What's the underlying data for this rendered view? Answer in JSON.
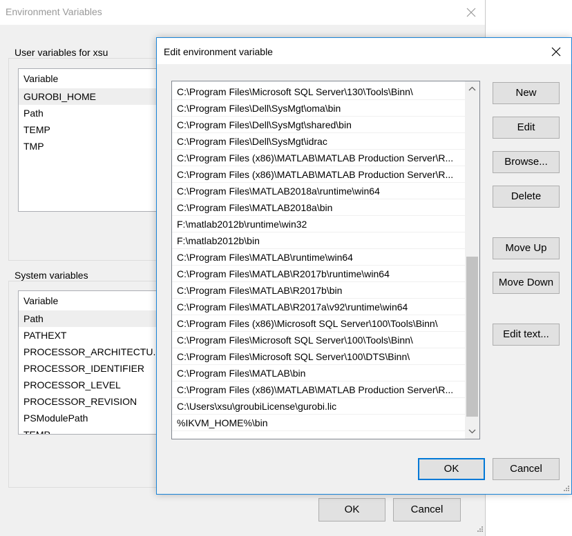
{
  "background_window": {
    "title": "Environment Variables",
    "user_group": {
      "label": "User variables for xsu",
      "column_header": "Variable",
      "rows": [
        "GUROBI_HOME",
        "Path",
        "TEMP",
        "TMP"
      ],
      "selected_index": 0
    },
    "system_group": {
      "label": "System variables",
      "column_header": "Variable",
      "rows": [
        "Path",
        "PATHEXT",
        "PROCESSOR_ARCHITECTU...",
        "PROCESSOR_IDENTIFIER",
        "PROCESSOR_LEVEL",
        "PROCESSOR_REVISION",
        "PSModulePath",
        "TEMP"
      ],
      "selected_index": 0
    },
    "buttons": {
      "ok": "OK",
      "cancel": "Cancel"
    }
  },
  "dialog": {
    "title": "Edit environment variable",
    "paths": [
      "C:\\Program Files\\Microsoft SQL Server\\130\\Tools\\Binn\\",
      "C:\\Program Files\\Dell\\SysMgt\\oma\\bin",
      "C:\\Program Files\\Dell\\SysMgt\\shared\\bin",
      "C:\\Program Files\\Dell\\SysMgt\\idrac",
      "C:\\Program Files (x86)\\MATLAB\\MATLAB Production Server\\R...",
      "C:\\Program Files (x86)\\MATLAB\\MATLAB Production Server\\R...",
      "C:\\Program Files\\MATLAB2018a\\runtime\\win64",
      "C:\\Program Files\\MATLAB2018a\\bin",
      "F:\\matlab2012b\\runtime\\win32",
      "F:\\matlab2012b\\bin",
      "C:\\Program Files\\MATLAB\\runtime\\win64",
      "C:\\Program Files\\MATLAB\\R2017b\\runtime\\win64",
      "C:\\Program Files\\MATLAB\\R2017b\\bin",
      "C:\\Program Files\\MATLAB\\R2017a\\v92\\runtime\\win64",
      "C:\\Program Files (x86)\\Microsoft SQL Server\\100\\Tools\\Binn\\",
      "C:\\Program Files\\Microsoft SQL Server\\100\\Tools\\Binn\\",
      "C:\\Program Files\\Microsoft SQL Server\\100\\DTS\\Binn\\",
      "C:\\Program Files\\MATLAB\\bin",
      "C:\\Program Files (x86)\\MATLAB\\MATLAB Production Server\\R...",
      "C:\\Users\\xsu\\groubiLicense\\gurobi.lic",
      "%IKVM_HOME%\\bin"
    ],
    "side_buttons": {
      "new": "New",
      "edit": "Edit",
      "browse": "Browse...",
      "delete": "Delete",
      "move_up": "Move Up",
      "move_down": "Move Down",
      "edit_text": "Edit text..."
    },
    "buttons": {
      "ok": "OK",
      "cancel": "Cancel"
    }
  },
  "colors": {
    "accent": "#0078d7",
    "dialog_border": "#1883d7",
    "button_face": "#e1e1e1"
  }
}
